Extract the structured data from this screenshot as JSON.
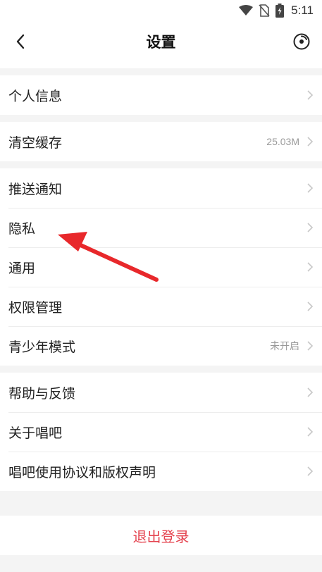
{
  "status_bar": {
    "time": "5:11",
    "icons": [
      "wifi-icon",
      "no-sim-icon",
      "battery-charging-icon"
    ]
  },
  "header": {
    "title": "设置",
    "back_icon": "chevron-left-icon",
    "action_icon": "record-icon"
  },
  "groups": [
    {
      "items": [
        {
          "label": "个人信息"
        }
      ]
    },
    {
      "items": [
        {
          "label": "清空缓存",
          "value": "25.03M"
        }
      ]
    },
    {
      "items": [
        {
          "label": "推送通知"
        },
        {
          "label": "隐私"
        },
        {
          "label": "通用"
        },
        {
          "label": "权限管理"
        },
        {
          "label": "青少年模式",
          "value": "未开启"
        }
      ]
    },
    {
      "items": [
        {
          "label": "帮助与反馈"
        },
        {
          "label": "关于唱吧"
        },
        {
          "label": "唱吧使用协议和版权声明"
        }
      ]
    }
  ],
  "logout_label": "退出登录",
  "colors": {
    "accent": "#e4424e",
    "annotation_arrow": "#e8282b",
    "background": "#f4f4f4",
    "secondary_text": "#999999"
  }
}
